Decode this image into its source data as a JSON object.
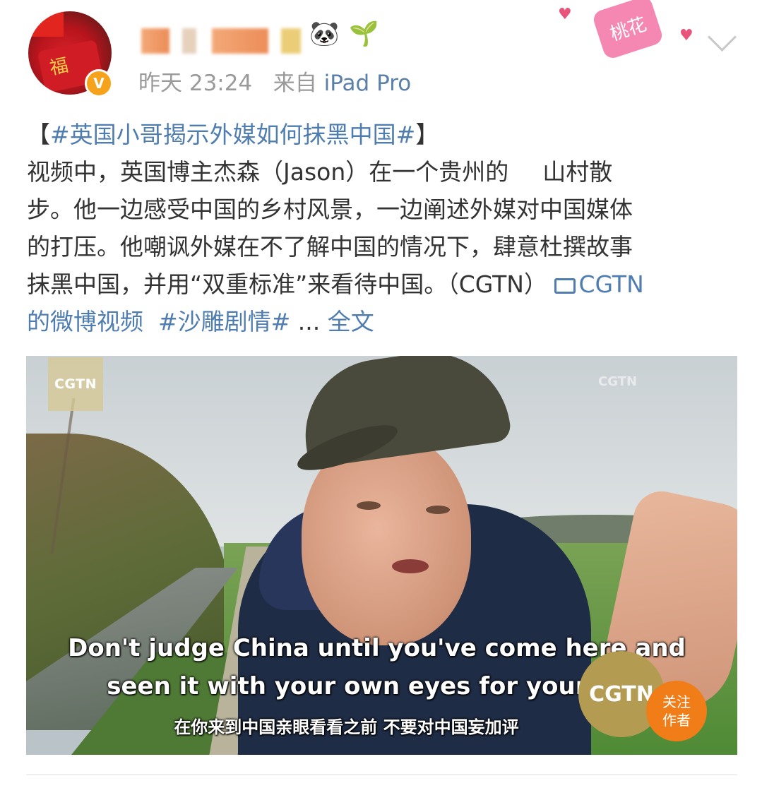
{
  "post": {
    "time": "昨天 23:24",
    "source_prefix": "来自",
    "source": "iPad Pro",
    "verified_badge": "V",
    "emoji_panda": "🐼",
    "emoji_sprout": "🌱",
    "deco_text": "桃花",
    "topic_open": "【",
    "topic": "#英国小哥揭示外媒如何抹黑中国#",
    "topic_close": "】",
    "line1a": "视频中，英国博主杰森（Jason）在一个贵州的",
    "line1b": "山村散",
    "line2": "步。他一边感受中国的乡村风景，一边阐述外媒对中国媒体",
    "line3": "的打压。他嘲讽外媒在不了解中国的情况下，肆意杜撰故事",
    "line4": "抹黑中国，并用“双重标准”来看待中国。（CGTN）",
    "video_link": "CGTN",
    "line5_link": "的微博视频",
    "tag2": "#沙雕剧情#",
    "ellipsis": "...",
    "full_text": "全文"
  },
  "video": {
    "logo": "CGTN",
    "watermark": "CGTN",
    "subtitle_en_1": "Don't judge China until you've come here and",
    "subtitle_en_2": "seen it with your own eyes for yours",
    "subtitle_zh": "在你来到中国亲眼看看之前 不要对中国妄加评",
    "circle_logo": "CGTN",
    "follow_label": "关注\n作者"
  },
  "colors": {
    "link": "#4f7db0",
    "meta": "#9a9a9a",
    "badge": "#f7a21b",
    "follow": "#f07d18"
  }
}
